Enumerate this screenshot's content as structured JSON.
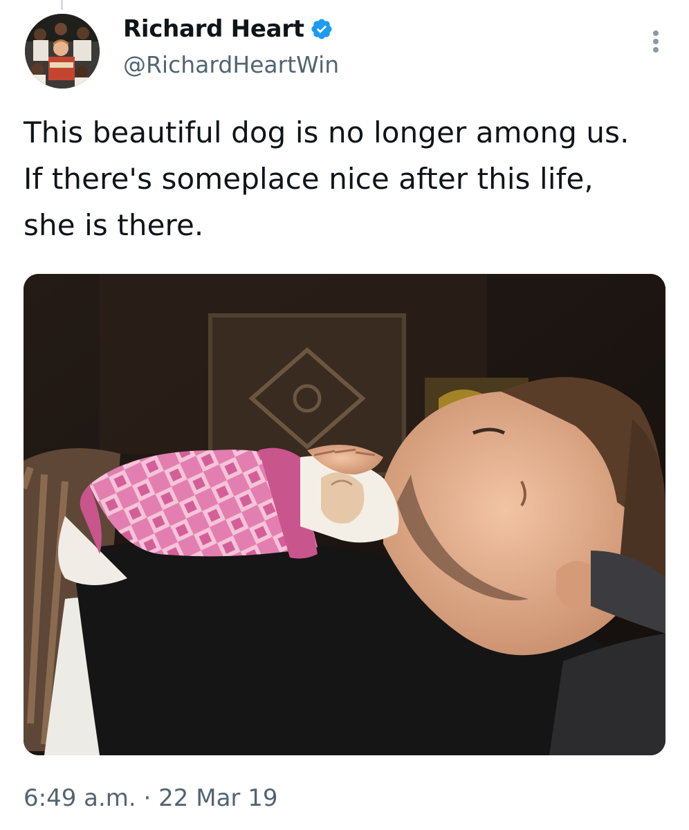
{
  "tweet": {
    "author": {
      "display_name": "Richard Heart",
      "handle": "@RichardHeartWin",
      "verified": true
    },
    "text": "This beautiful dog is no longer among us. If there's someplace nice after this life, she is there.",
    "media": {
      "kind": "photo",
      "alt": "A man sleeping with a small white dog in a pink argyle sweater on his chest"
    },
    "time": "6:49 a.m.",
    "separator": "·",
    "date": "22 Mar 19"
  },
  "colors": {
    "verified_badge": "#1d9bf0",
    "secondary_text": "#536471",
    "primary_text": "#0f1419",
    "sweater_pink": "#d96aa0"
  },
  "icons": [
    "verified-badge-icon",
    "more-options-icon"
  ]
}
